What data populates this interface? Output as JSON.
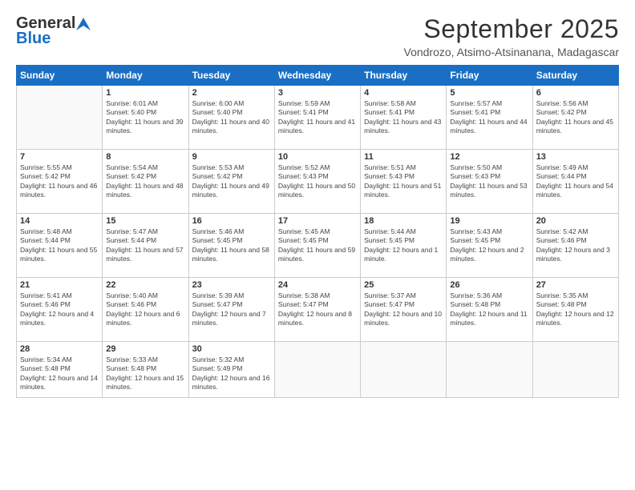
{
  "header": {
    "logo_general": "General",
    "logo_blue": "Blue",
    "month": "September 2025",
    "location": "Vondrozo, Atsimo-Atsinanana, Madagascar"
  },
  "days_of_week": [
    "Sunday",
    "Monday",
    "Tuesday",
    "Wednesday",
    "Thursday",
    "Friday",
    "Saturday"
  ],
  "weeks": [
    [
      {
        "day": "",
        "sunrise": "",
        "sunset": "",
        "daylight": ""
      },
      {
        "day": "1",
        "sunrise": "Sunrise: 6:01 AM",
        "sunset": "Sunset: 5:40 PM",
        "daylight": "Daylight: 11 hours and 39 minutes."
      },
      {
        "day": "2",
        "sunrise": "Sunrise: 6:00 AM",
        "sunset": "Sunset: 5:40 PM",
        "daylight": "Daylight: 11 hours and 40 minutes."
      },
      {
        "day": "3",
        "sunrise": "Sunrise: 5:59 AM",
        "sunset": "Sunset: 5:41 PM",
        "daylight": "Daylight: 11 hours and 41 minutes."
      },
      {
        "day": "4",
        "sunrise": "Sunrise: 5:58 AM",
        "sunset": "Sunset: 5:41 PM",
        "daylight": "Daylight: 11 hours and 43 minutes."
      },
      {
        "day": "5",
        "sunrise": "Sunrise: 5:57 AM",
        "sunset": "Sunset: 5:41 PM",
        "daylight": "Daylight: 11 hours and 44 minutes."
      },
      {
        "day": "6",
        "sunrise": "Sunrise: 5:56 AM",
        "sunset": "Sunset: 5:42 PM",
        "daylight": "Daylight: 11 hours and 45 minutes."
      }
    ],
    [
      {
        "day": "7",
        "sunrise": "Sunrise: 5:55 AM",
        "sunset": "Sunset: 5:42 PM",
        "daylight": "Daylight: 11 hours and 46 minutes."
      },
      {
        "day": "8",
        "sunrise": "Sunrise: 5:54 AM",
        "sunset": "Sunset: 5:42 PM",
        "daylight": "Daylight: 11 hours and 48 minutes."
      },
      {
        "day": "9",
        "sunrise": "Sunrise: 5:53 AM",
        "sunset": "Sunset: 5:42 PM",
        "daylight": "Daylight: 11 hours and 49 minutes."
      },
      {
        "day": "10",
        "sunrise": "Sunrise: 5:52 AM",
        "sunset": "Sunset: 5:43 PM",
        "daylight": "Daylight: 11 hours and 50 minutes."
      },
      {
        "day": "11",
        "sunrise": "Sunrise: 5:51 AM",
        "sunset": "Sunset: 5:43 PM",
        "daylight": "Daylight: 11 hours and 51 minutes."
      },
      {
        "day": "12",
        "sunrise": "Sunrise: 5:50 AM",
        "sunset": "Sunset: 5:43 PM",
        "daylight": "Daylight: 11 hours and 53 minutes."
      },
      {
        "day": "13",
        "sunrise": "Sunrise: 5:49 AM",
        "sunset": "Sunset: 5:44 PM",
        "daylight": "Daylight: 11 hours and 54 minutes."
      }
    ],
    [
      {
        "day": "14",
        "sunrise": "Sunrise: 5:48 AM",
        "sunset": "Sunset: 5:44 PM",
        "daylight": "Daylight: 11 hours and 55 minutes."
      },
      {
        "day": "15",
        "sunrise": "Sunrise: 5:47 AM",
        "sunset": "Sunset: 5:44 PM",
        "daylight": "Daylight: 11 hours and 57 minutes."
      },
      {
        "day": "16",
        "sunrise": "Sunrise: 5:46 AM",
        "sunset": "Sunset: 5:45 PM",
        "daylight": "Daylight: 11 hours and 58 minutes."
      },
      {
        "day": "17",
        "sunrise": "Sunrise: 5:45 AM",
        "sunset": "Sunset: 5:45 PM",
        "daylight": "Daylight: 11 hours and 59 minutes."
      },
      {
        "day": "18",
        "sunrise": "Sunrise: 5:44 AM",
        "sunset": "Sunset: 5:45 PM",
        "daylight": "Daylight: 12 hours and 1 minute."
      },
      {
        "day": "19",
        "sunrise": "Sunrise: 5:43 AM",
        "sunset": "Sunset: 5:45 PM",
        "daylight": "Daylight: 12 hours and 2 minutes."
      },
      {
        "day": "20",
        "sunrise": "Sunrise: 5:42 AM",
        "sunset": "Sunset: 5:46 PM",
        "daylight": "Daylight: 12 hours and 3 minutes."
      }
    ],
    [
      {
        "day": "21",
        "sunrise": "Sunrise: 5:41 AM",
        "sunset": "Sunset: 5:46 PM",
        "daylight": "Daylight: 12 hours and 4 minutes."
      },
      {
        "day": "22",
        "sunrise": "Sunrise: 5:40 AM",
        "sunset": "Sunset: 5:46 PM",
        "daylight": "Daylight: 12 hours and 6 minutes."
      },
      {
        "day": "23",
        "sunrise": "Sunrise: 5:39 AM",
        "sunset": "Sunset: 5:47 PM",
        "daylight": "Daylight: 12 hours and 7 minutes."
      },
      {
        "day": "24",
        "sunrise": "Sunrise: 5:38 AM",
        "sunset": "Sunset: 5:47 PM",
        "daylight": "Daylight: 12 hours and 8 minutes."
      },
      {
        "day": "25",
        "sunrise": "Sunrise: 5:37 AM",
        "sunset": "Sunset: 5:47 PM",
        "daylight": "Daylight: 12 hours and 10 minutes."
      },
      {
        "day": "26",
        "sunrise": "Sunrise: 5:36 AM",
        "sunset": "Sunset: 5:48 PM",
        "daylight": "Daylight: 12 hours and 11 minutes."
      },
      {
        "day": "27",
        "sunrise": "Sunrise: 5:35 AM",
        "sunset": "Sunset: 5:48 PM",
        "daylight": "Daylight: 12 hours and 12 minutes."
      }
    ],
    [
      {
        "day": "28",
        "sunrise": "Sunrise: 5:34 AM",
        "sunset": "Sunset: 5:48 PM",
        "daylight": "Daylight: 12 hours and 14 minutes."
      },
      {
        "day": "29",
        "sunrise": "Sunrise: 5:33 AM",
        "sunset": "Sunset: 5:48 PM",
        "daylight": "Daylight: 12 hours and 15 minutes."
      },
      {
        "day": "30",
        "sunrise": "Sunrise: 5:32 AM",
        "sunset": "Sunset: 5:49 PM",
        "daylight": "Daylight: 12 hours and 16 minutes."
      },
      {
        "day": "",
        "sunrise": "",
        "sunset": "",
        "daylight": ""
      },
      {
        "day": "",
        "sunrise": "",
        "sunset": "",
        "daylight": ""
      },
      {
        "day": "",
        "sunrise": "",
        "sunset": "",
        "daylight": ""
      },
      {
        "day": "",
        "sunrise": "",
        "sunset": "",
        "daylight": ""
      }
    ]
  ]
}
